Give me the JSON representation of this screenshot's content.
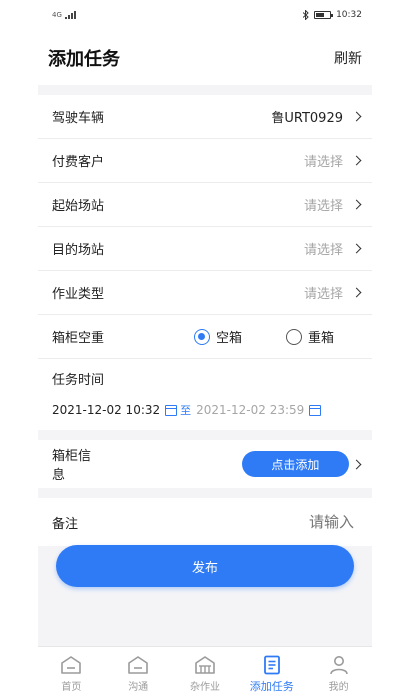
{
  "status_bar": {
    "network": "4G",
    "time": "10:32"
  },
  "header": {
    "title": "添加任务",
    "refresh": "刷新"
  },
  "form": {
    "vehicle": {
      "label": "驾驶车辆",
      "value": "鲁URT0929"
    },
    "customer": {
      "label": "付费客户",
      "placeholder": "请选择"
    },
    "start_station": {
      "label": "起始场站",
      "placeholder": "请选择"
    },
    "dest_station": {
      "label": "目的场站",
      "placeholder": "请选择"
    },
    "job_type": {
      "label": "作业类型",
      "placeholder": "请选择"
    },
    "load_state": {
      "label": "箱柜空重",
      "options": [
        "空箱",
        "重箱"
      ],
      "selected": "空箱"
    },
    "task_time": {
      "label": "任务时间",
      "start": "2021-12-02 10:32",
      "separator": "至",
      "end": "2021-12-02 23:59"
    },
    "container": {
      "label": "箱柜信息",
      "add_button": "点击添加"
    },
    "remark": {
      "label": "备注",
      "placeholder": "请输入"
    }
  },
  "publish_button": "发布",
  "tabbar": {
    "items": [
      {
        "label": "首页",
        "icon": "home-icon"
      },
      {
        "label": "沟通",
        "icon": "chat-icon"
      },
      {
        "label": "杂作业",
        "icon": "warehouse-icon"
      },
      {
        "label": "添加任务",
        "icon": "document-icon"
      },
      {
        "label": "我的",
        "icon": "person-icon"
      }
    ],
    "active": "添加任务"
  },
  "colors": {
    "accent": "#2f7bf6",
    "placeholder": "#a6a6a6",
    "background": "#f4f4f6"
  }
}
